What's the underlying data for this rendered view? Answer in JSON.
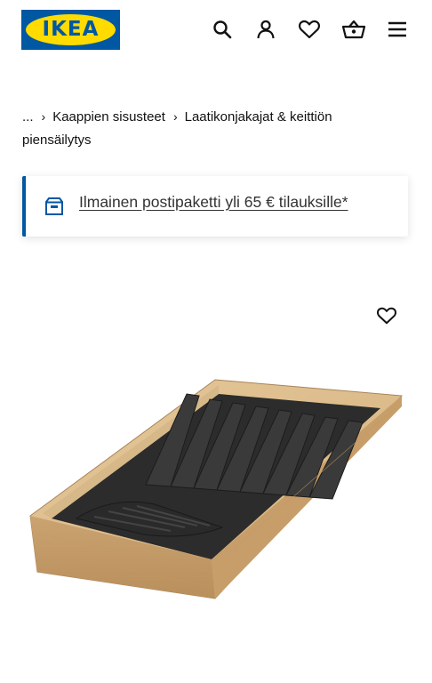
{
  "header": {
    "logo_text": "IKEA",
    "icons": [
      "search-icon",
      "account-icon",
      "heart-icon",
      "basket-icon",
      "menu-icon"
    ]
  },
  "breadcrumb": {
    "ellipsis": "...",
    "items": [
      "Kaappien sisusteet",
      "Laatikonjakajat & keittiön piensäilytys"
    ]
  },
  "promo": {
    "text": "Ilmainen postipaketti yli 65 € tilauksille*",
    "accent_color": "#0058a3"
  },
  "product": {
    "image_alt": "Bamboo knife tray with dark blade slots",
    "favourite_icon": "heart-icon"
  },
  "colors": {
    "brand_blue": "#0058a3",
    "brand_yellow": "#ffdb00"
  }
}
